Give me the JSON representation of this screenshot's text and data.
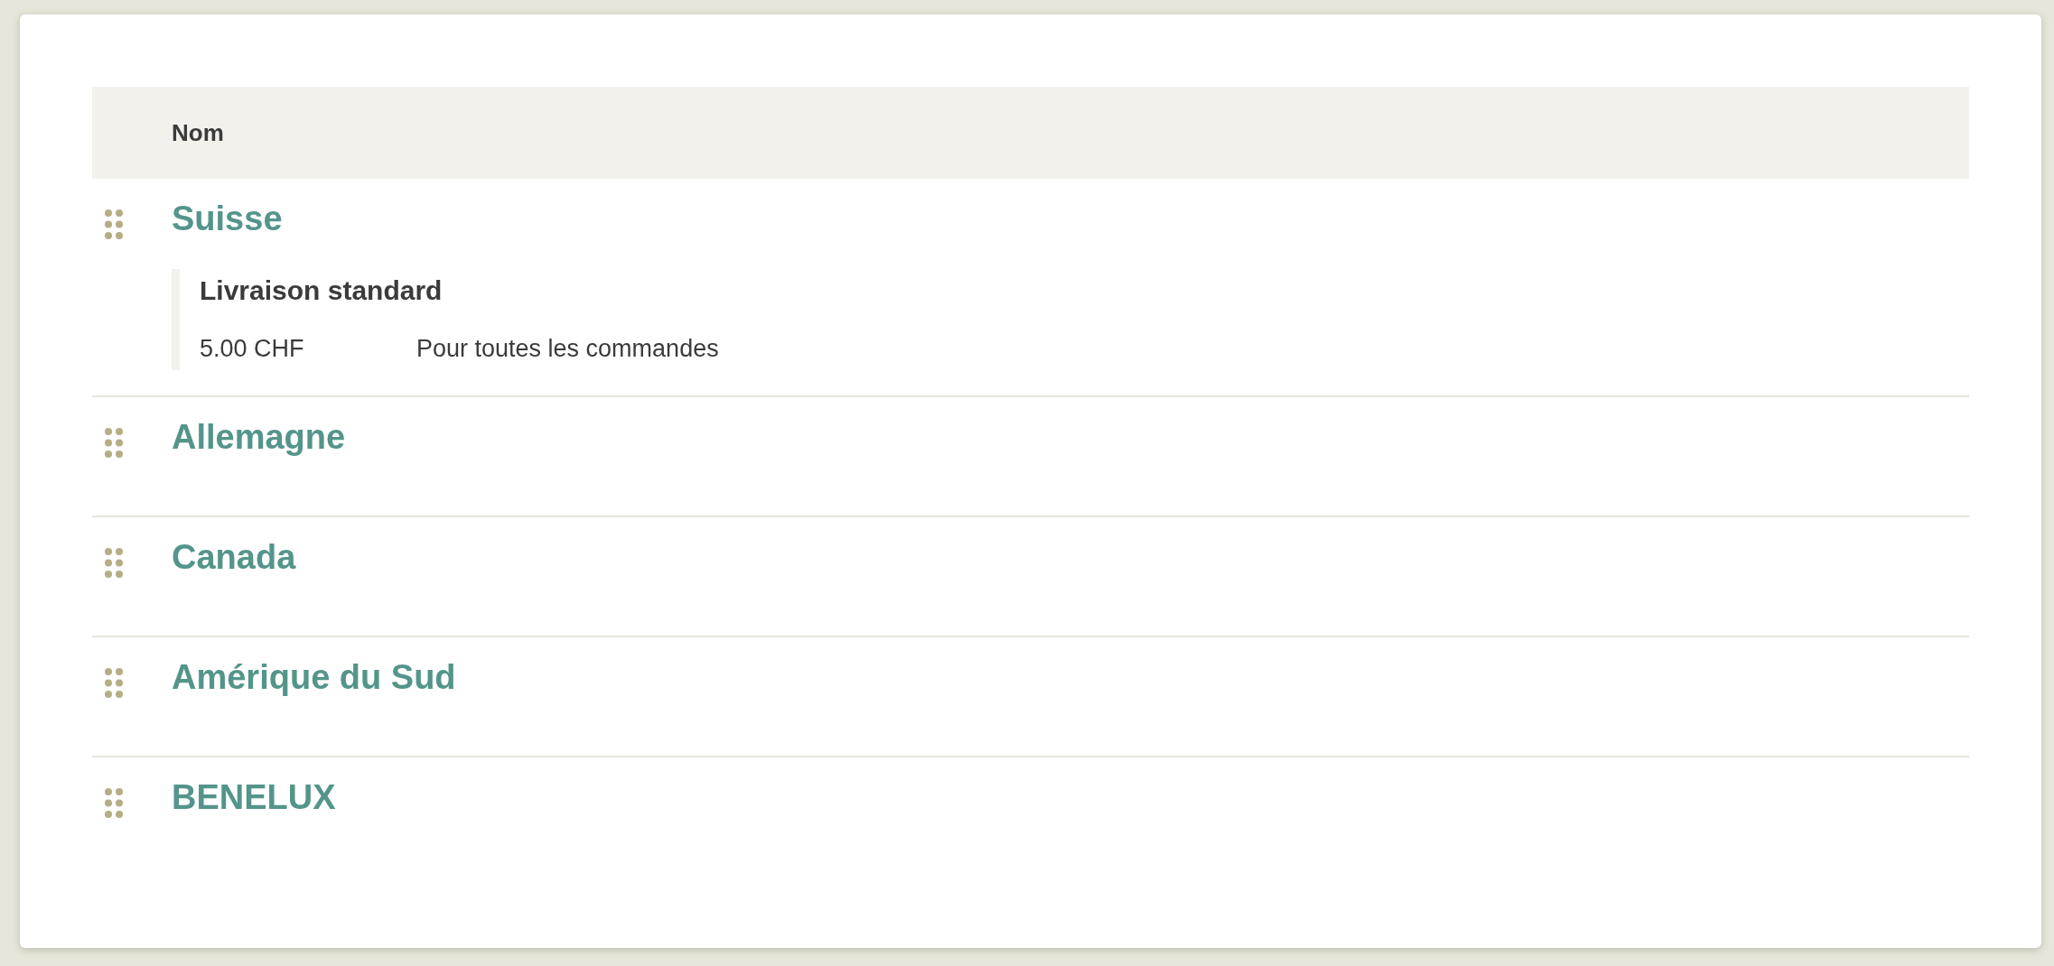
{
  "table": {
    "columns": [
      "Nom"
    ],
    "rows": [
      {
        "name": "Suisse",
        "shipping_methods": [
          {
            "name": "Livraison standard",
            "price": "5.00 CHF",
            "condition": "Pour toutes les commandes"
          }
        ]
      },
      {
        "name": "Allemagne"
      },
      {
        "name": "Canada"
      },
      {
        "name": "Amérique du Sud"
      },
      {
        "name": "BENELUX"
      }
    ]
  }
}
